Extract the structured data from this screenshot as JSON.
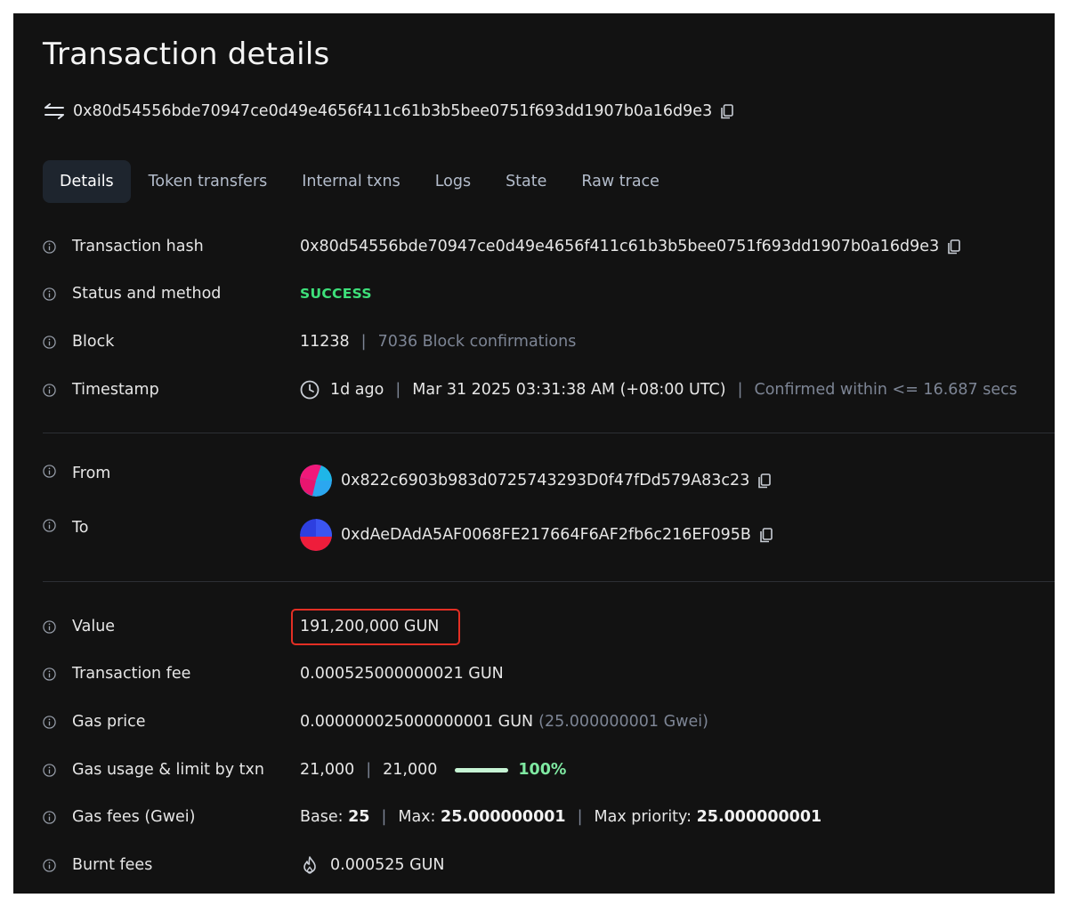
{
  "page": {
    "title": "Transaction details",
    "hash": "0x80d54556bde70947ce0d49e4656f411c61b3b5bee0751f693dd1907b0a16d9e3"
  },
  "tabs": [
    "Details",
    "Token transfers",
    "Internal txns",
    "Logs",
    "State",
    "Raw trace"
  ],
  "active_tab": "Details",
  "rows": {
    "tx_hash": {
      "label": "Transaction hash",
      "value": "0x80d54556bde70947ce0d49e4656f411c61b3b5bee0751f693dd1907b0a16d9e3"
    },
    "status": {
      "label": "Status and method",
      "value": "SUCCESS"
    },
    "block": {
      "label": "Block",
      "number": "11238",
      "confirmations": "7036 Block confirmations"
    },
    "timestamp": {
      "label": "Timestamp",
      "ago": "1d ago",
      "datetime": "Mar 31 2025 03:31:38 AM (+08:00 UTC)",
      "confirmed": "Confirmed within <= 16.687 secs"
    },
    "from": {
      "label": "From",
      "address": "0x822c6903b983d0725743293D0f47fDd579A83c23"
    },
    "to": {
      "label": "To",
      "address": "0xdAeDAdA5AF0068FE217664F6AF2fb6c216EF095B"
    },
    "value": {
      "label": "Value",
      "value": "191,200,000 GUN"
    },
    "tx_fee": {
      "label": "Transaction fee",
      "value": "0.000525000000021 GUN"
    },
    "gas_price": {
      "label": "Gas price",
      "value": "0.000000025000000001 GUN",
      "gwei": "(25.000000001 Gwei)"
    },
    "gas_usage": {
      "label": "Gas usage & limit by txn",
      "usage": "21,000",
      "limit": "21,000",
      "percent": "100%",
      "fill": 1.0
    },
    "gas_fees": {
      "label": "Gas fees (Gwei)",
      "base_label": "Base:",
      "base": "25",
      "max_label": "Max:",
      "max": "25.000000001",
      "max_priority_label": "Max priority:",
      "max_priority": "25.000000001"
    },
    "burnt": {
      "label": "Burnt fees",
      "value": "0.000525 GUN"
    }
  },
  "colors": {
    "success": "#3ee07a",
    "highlight": "#e32f24",
    "background": "#121212"
  },
  "icons": [
    "swap-arrows-icon",
    "copy-icon",
    "info-icon",
    "clock-icon",
    "flame-icon"
  ]
}
